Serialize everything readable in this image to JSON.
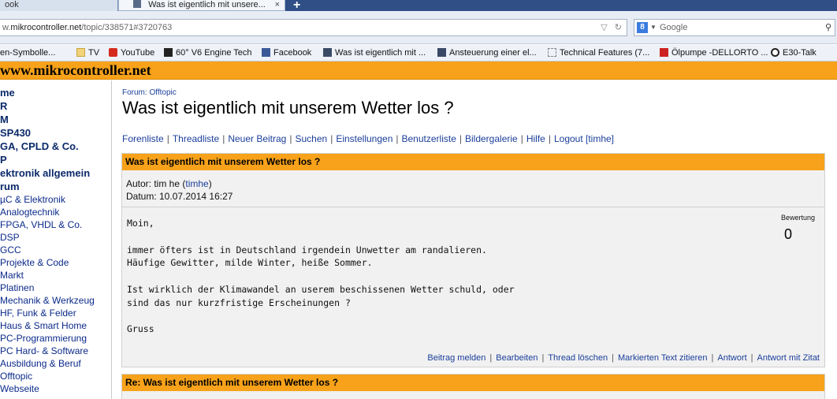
{
  "browser": {
    "tabs": [
      {
        "label": "ook"
      },
      {
        "label": "Was ist eigentlich mit unsere..."
      }
    ],
    "tab_close": "×",
    "new_tab": "+",
    "url_prefix": "w.",
    "url_host": "mikrocontroller.net",
    "url_path": "/topic/338571#3720763",
    "search_engine_icon": "8",
    "search_placeholder": "Google",
    "bookmarks": [
      {
        "label": "en-Symbolle...",
        "icon": "none"
      },
      {
        "label": "TV",
        "icon": "folder-icon"
      },
      {
        "label": "YouTube",
        "icon": "youtube-icon"
      },
      {
        "label": "60° V6 Engine Tech",
        "icon": "ft-icon"
      },
      {
        "label": "Facebook",
        "icon": "facebook-icon"
      },
      {
        "label": "Was ist eigentlich mit ...",
        "icon": "mc-icon"
      },
      {
        "label": "Ansteuerung einer el...",
        "icon": "mc-icon"
      },
      {
        "label": "Technical Features (7...",
        "icon": "page-icon"
      },
      {
        "label": "Ölpumpe -DELLORTO ...",
        "icon": "sc-icon"
      },
      {
        "label": "E30-Talk",
        "icon": "bmw-icon"
      }
    ]
  },
  "site": {
    "title": "www.mikrocontroller.net"
  },
  "sidebar": {
    "items": [
      {
        "label": "me",
        "bold": true
      },
      {
        "label": "R",
        "bold": true
      },
      {
        "label": "M",
        "bold": true
      },
      {
        "label": "SP430",
        "bold": true
      },
      {
        "label": "GA, CPLD & Co.",
        "bold": true
      },
      {
        "label": "P",
        "bold": true
      },
      {
        "label": "ektronik allgemein",
        "bold": true
      },
      {
        "label": "rum",
        "bold": true
      },
      {
        "label": "µC & Elektronik",
        "bold": false
      },
      {
        "label": "Analogtechnik",
        "bold": false
      },
      {
        "label": "FPGA, VHDL & Co.",
        "bold": false
      },
      {
        "label": "DSP",
        "bold": false
      },
      {
        "label": "GCC",
        "bold": false
      },
      {
        "label": "Projekte & Code",
        "bold": false
      },
      {
        "label": "Markt",
        "bold": false
      },
      {
        "label": "Platinen",
        "bold": false
      },
      {
        "label": "Mechanik & Werkzeug",
        "bold": false
      },
      {
        "label": "HF, Funk & Felder",
        "bold": false
      },
      {
        "label": "Haus & Smart Home",
        "bold": false
      },
      {
        "label": "PC-Programmierung",
        "bold": false
      },
      {
        "label": "PC Hard- & Software",
        "bold": false
      },
      {
        "label": "Ausbildung & Beruf",
        "bold": false
      },
      {
        "label": "Offtopic",
        "bold": false
      },
      {
        "label": "Webseite",
        "bold": false
      }
    ]
  },
  "main": {
    "forum_label": "Forum: Offtopic",
    "title": "Was ist eigentlich mit unserem Wetter los ?",
    "nav": [
      "Forenliste",
      "Threadliste",
      "Neuer Beitrag",
      "Suchen",
      "Einstellungen",
      "Benutzerliste",
      "Bildergalerie",
      "Hilfe",
      "Logout [timhe]"
    ],
    "post": {
      "title": "Was ist eigentlich mit unserem Wetter los ?",
      "author_prefix": "Autor: tim he (",
      "author_user": "timhe",
      "author_suffix": ")",
      "date": "Datum: 10.07.2014 16:27",
      "body": "Moin,\n\nimmer öfters ist in Deutschland irgendein Unwetter am randalieren.\nHäufige Gewitter, milde Winter, heiße Sommer.\n\nIst wirklich der Klimawandel an userem beschissenen Wetter schuld, oder\nsind das nur kurzfristige Erscheinungen ?\n\nGruss",
      "rating_label": "Bewertung",
      "rating_value": "0",
      "actions": [
        "Beitrag melden",
        "Bearbeiten",
        "Thread löschen",
        "Markierten Text zitieren",
        "Antwort",
        "Antwort mit Zitat"
      ]
    },
    "reply": {
      "title": "Re: Was ist eigentlich mit unserem Wetter los ?"
    }
  },
  "colors": {
    "accent": "#f7a21a",
    "link": "#1a3e9a",
    "sidebar_link": "#0b2a8a"
  }
}
